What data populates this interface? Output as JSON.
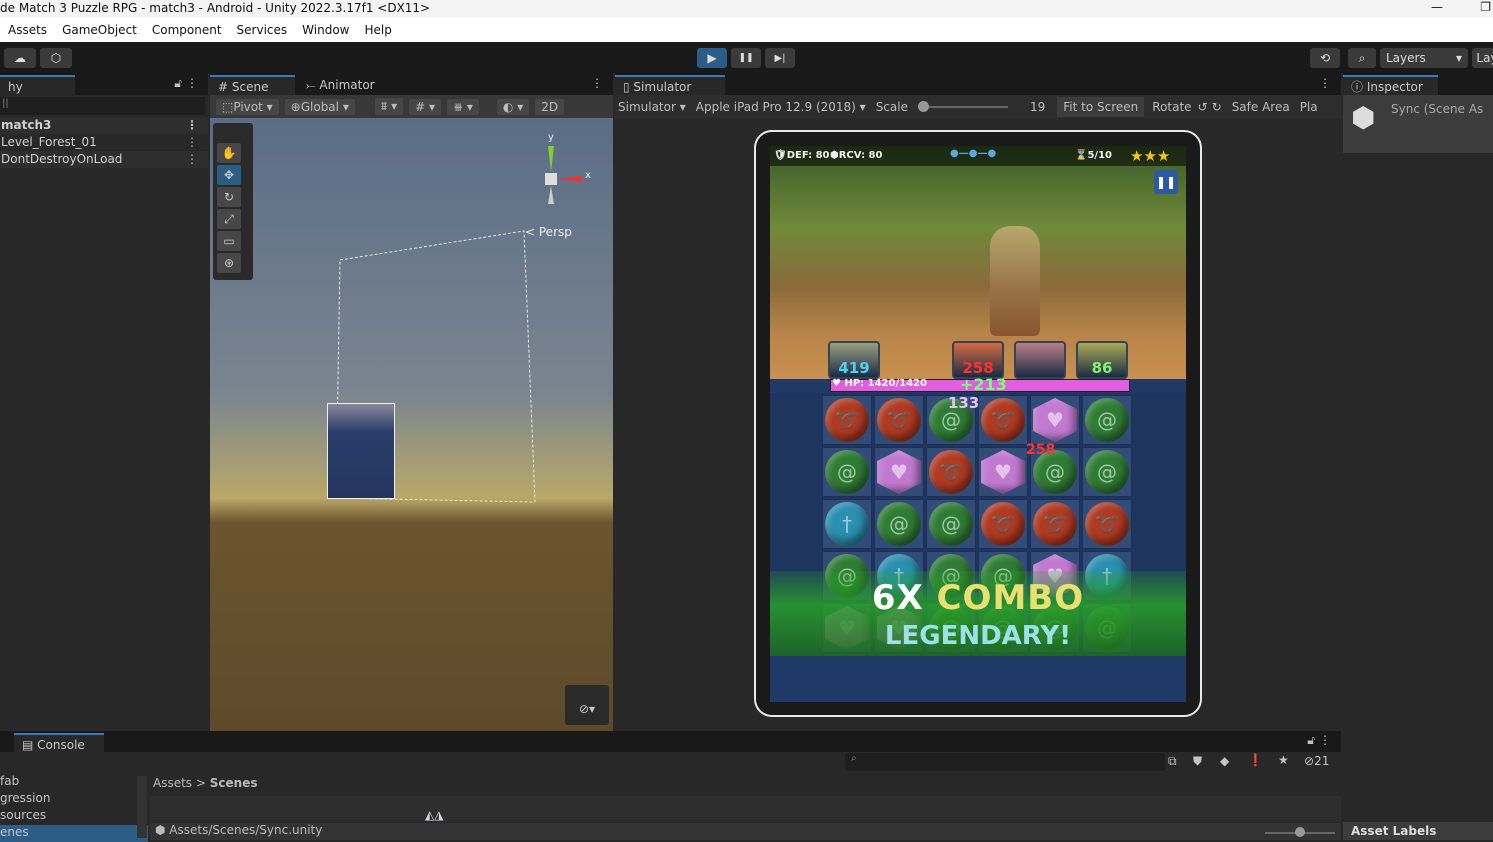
{
  "window": {
    "title": "de Match 3 Puzzle RPG - match3 - Android - Unity 2022.3.17f1 <DX11>"
  },
  "menu": [
    "Assets",
    "GameObject",
    "Component",
    "Services",
    "Window",
    "Help"
  ],
  "toolbar": {
    "play": "▶",
    "pause": "❚❚",
    "step": "▶|",
    "layers": "Layers",
    "layout": "Lay",
    "cloud_icon": "cloud-icon",
    "history_icon": "history-icon",
    "search_icon": "search-icon"
  },
  "hierarchy": {
    "tab": "hy",
    "search_placeholder": "ll",
    "items": [
      "match3",
      "Level_Forest_01",
      "DontDestroyOnLoad"
    ]
  },
  "scene": {
    "tabs": [
      "Scene",
      "Animator"
    ],
    "pivot": "Pivot",
    "global": "Global",
    "mode_2d": "2D",
    "persp": "Persp",
    "axis_x": "x",
    "axis_y": "y"
  },
  "simulator": {
    "tab": "Simulator",
    "mode": "Simulator",
    "device": "Apple iPad Pro 12.9 (2018)",
    "scale_label": "Scale",
    "scale_value": "19",
    "scale_fraction": 0.1,
    "fit": "Fit to Screen",
    "rotate": "Rotate",
    "safe_area": "Safe Area",
    "play_mode": "Pla"
  },
  "game": {
    "def": "DEF: 80",
    "rcv": "RCV: 80",
    "turns": "5/10",
    "stars": 3,
    "hp": "HP: 1420/1420",
    "hp_fraction": 1.0,
    "heal": "+213",
    "dmg1": "133",
    "dmg2": "258",
    "heroes": [
      {
        "value": "419",
        "color": "#4fd0f0"
      },
      {
        "value": "258",
        "color": "#ff3030"
      },
      {
        "value": "",
        "color": "#b070ff"
      },
      {
        "value": "86",
        "color": "#80f070"
      }
    ],
    "combo_count": "6X",
    "combo_word": "COMBO",
    "combo_rank": "LEGENDARY!",
    "board": [
      [
        "red",
        "red",
        "green",
        "red",
        "heart",
        "green"
      ],
      [
        "green",
        "heart",
        "red",
        "heart",
        "green",
        "green"
      ],
      [
        "blue",
        "green",
        "green",
        "red",
        "red",
        "red"
      ],
      [
        "green",
        "blue",
        "green",
        "green",
        "heart",
        "blue"
      ],
      [
        "heart",
        "heart",
        "green",
        "green",
        "green",
        "green"
      ]
    ],
    "gem_colors": {
      "red": "#b03a22",
      "green": "#2f7d35",
      "blue": "#2a8fb0",
      "heart": "#c27ad0"
    }
  },
  "inspector": {
    "tab": "Inspector",
    "title": "Sync (Scene As"
  },
  "console": {
    "tab": "Console",
    "count": "21"
  },
  "project": {
    "folders": [
      "fab",
      "gression",
      "sources",
      "enes"
    ],
    "breadcrumb": [
      "Assets",
      "Scenes"
    ],
    "path": "Assets/Scenes/Sync.unity",
    "asset_labels": "Asset Labels"
  }
}
